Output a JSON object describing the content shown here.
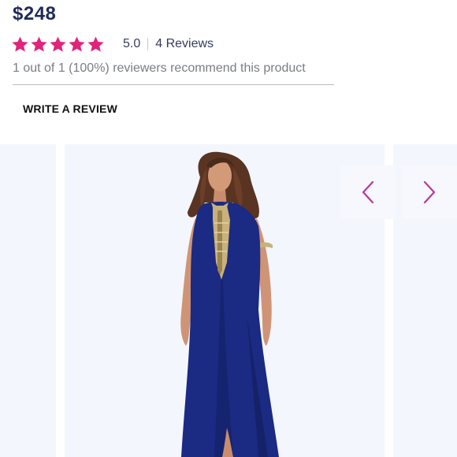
{
  "product": {
    "price": "$248"
  },
  "rating": {
    "stars_filled": 5,
    "stars_total": 5,
    "score_text": "5.0",
    "reviews_link": "4 Reviews",
    "recommend_text": "1 out of 1 (100%) reviewers recommend this product",
    "star_icon": "star-icon",
    "star_color": "#e2237a"
  },
  "actions": {
    "write_review_label": "WRITE A REVIEW"
  },
  "gallery": {
    "prev_icon": "chevron-left-icon",
    "next_icon": "chevron-right-icon",
    "arrow_color": "#b8389b",
    "image_subject": "model in navy embellished maxi dress",
    "dress_color": "#1b2a82",
    "embellishment_color": "#c8b27a"
  },
  "colors": {
    "price": "#1f2a5c",
    "slide_background": "#f3f6fd"
  }
}
